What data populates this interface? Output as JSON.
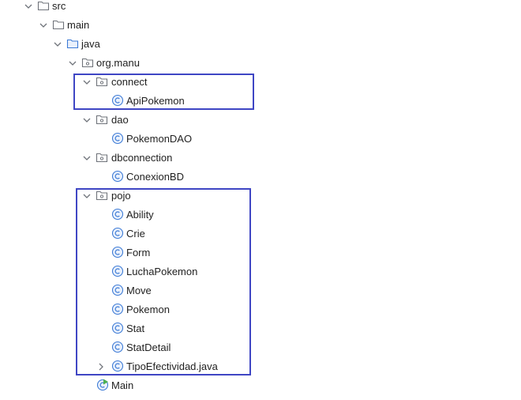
{
  "tree": {
    "src": "src",
    "main": "main",
    "java": "java",
    "org_manu": "org.manu",
    "connect": "connect",
    "api_pokemon": "ApiPokemon",
    "dao": "dao",
    "pokemon_dao": "PokemonDAO",
    "dbconnection": "dbconnection",
    "conexion_bd": "ConexionBD",
    "pojo": "pojo",
    "pojo_classes": [
      "Ability",
      "Crie",
      "Form",
      "LuchaPokemon",
      "Move",
      "Pokemon",
      "Stat",
      "StatDetail",
      "TipoEfectividad.java"
    ],
    "main_class": "Main"
  },
  "colors": {
    "highlight_border": "#3f46c4",
    "class_icon": "#3d7bd6",
    "chevron": "#6f737a",
    "folder": "#6f737a",
    "main_run_badge": "#4caf50"
  }
}
